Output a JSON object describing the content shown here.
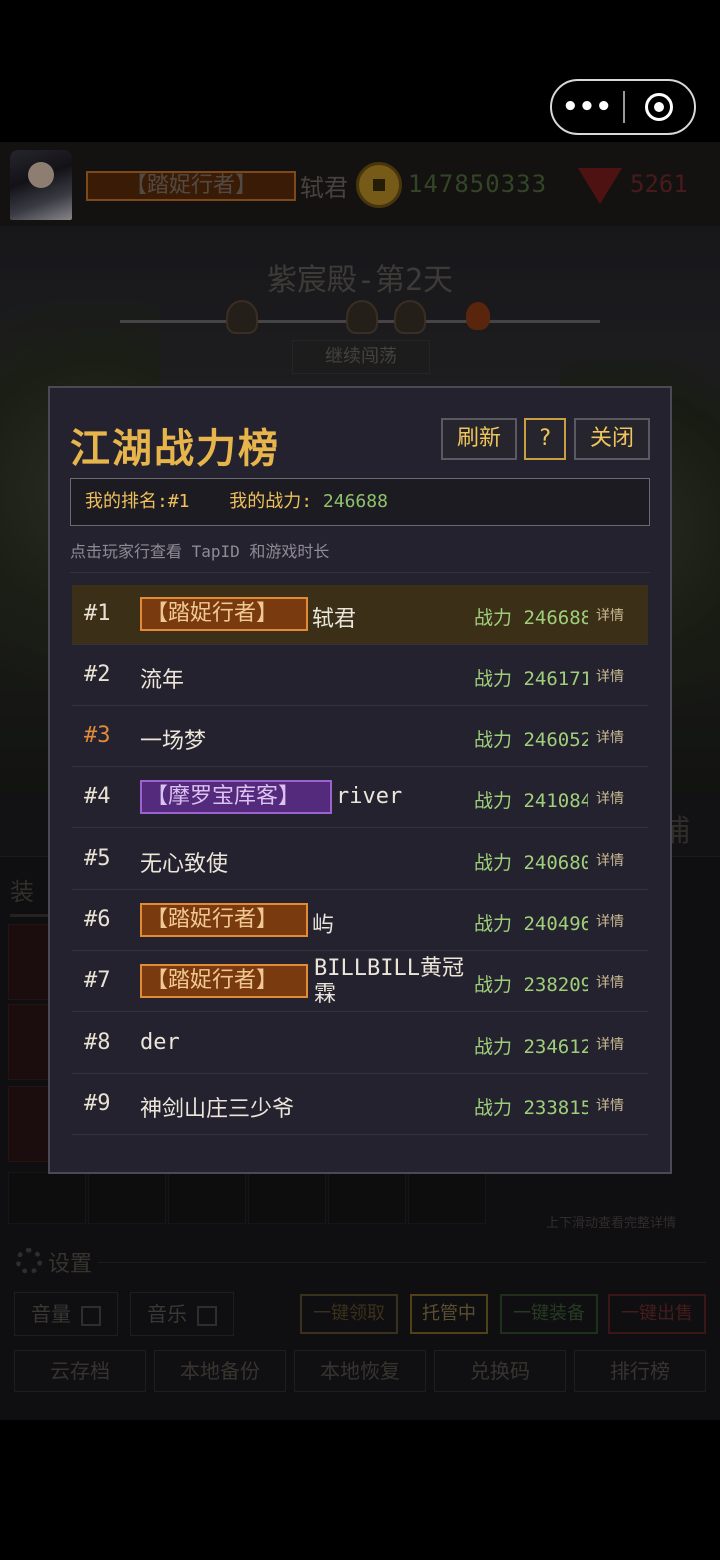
{
  "header": {
    "title_tag": "【踏娖行者】",
    "player_name": "轼君",
    "coins": "147850333",
    "gems": "5261",
    "icons": [
      "avatar",
      "coin-icon",
      "gem-icon"
    ]
  },
  "scene": {
    "stage": "紫宸殿-第2天",
    "continue_label": "继续闯荡"
  },
  "modal": {
    "title": "江湖战力榜",
    "refresh_label": "刷新",
    "help_label": "?",
    "close_label": "关闭",
    "my_rank_label": "我的排名:",
    "my_rank_value": "#1",
    "my_power_label": "我的战力:",
    "my_power_value": "246688",
    "tip": "点击玩家行查看 TapID 和游戏时长",
    "power_prefix": "战力",
    "detail_label": "详情",
    "rows": [
      {
        "rank": "#1",
        "badge": "【踏娖行者】",
        "name": "轼君",
        "power": "246688"
      },
      {
        "rank": "#2",
        "badge": "",
        "name": "流年",
        "power": "246171"
      },
      {
        "rank": "#3",
        "badge": "",
        "name": "一场梦",
        "power": "246052"
      },
      {
        "rank": "#4",
        "badge": "【摩罗宝库客】",
        "name": "river",
        "power": "241084"
      },
      {
        "rank": "#5",
        "badge": "",
        "name": "无心致使",
        "power": "240680"
      },
      {
        "rank": "#6",
        "badge": "【踏娖行者】",
        "name": "屿",
        "power": "240496"
      },
      {
        "rank": "#7",
        "badge": "【踏娖行者】",
        "name": "BILLBILL黄冠霖",
        "power": "238209"
      },
      {
        "rank": "#8",
        "badge": "",
        "name": "der",
        "power": "234612"
      },
      {
        "rank": "#9",
        "badge": "",
        "name": "神剑山庄三少爷",
        "power": "233815"
      }
    ]
  },
  "background": {
    "equip_tab": "装",
    "strip_right": "捕",
    "scroll_hint": "上下滑动查看完整详情",
    "settings_title": "设置",
    "volume_label": "音量",
    "music_label": "音乐",
    "action_buttons": [
      "一键领取",
      "托管中",
      "一键装备",
      "一键出售"
    ],
    "bottom_buttons": [
      "云存档",
      "本地备份",
      "本地恢复",
      "兑换码",
      "排行榜"
    ]
  },
  "colors": {
    "modal_bg": "#23222e",
    "title_gold": "#e7b54b",
    "power_green": "#9fcf7a",
    "badge_orange": "#e28a38",
    "badge_purple": "#9b62d0",
    "rank3_bronze": "#e08a3c"
  }
}
